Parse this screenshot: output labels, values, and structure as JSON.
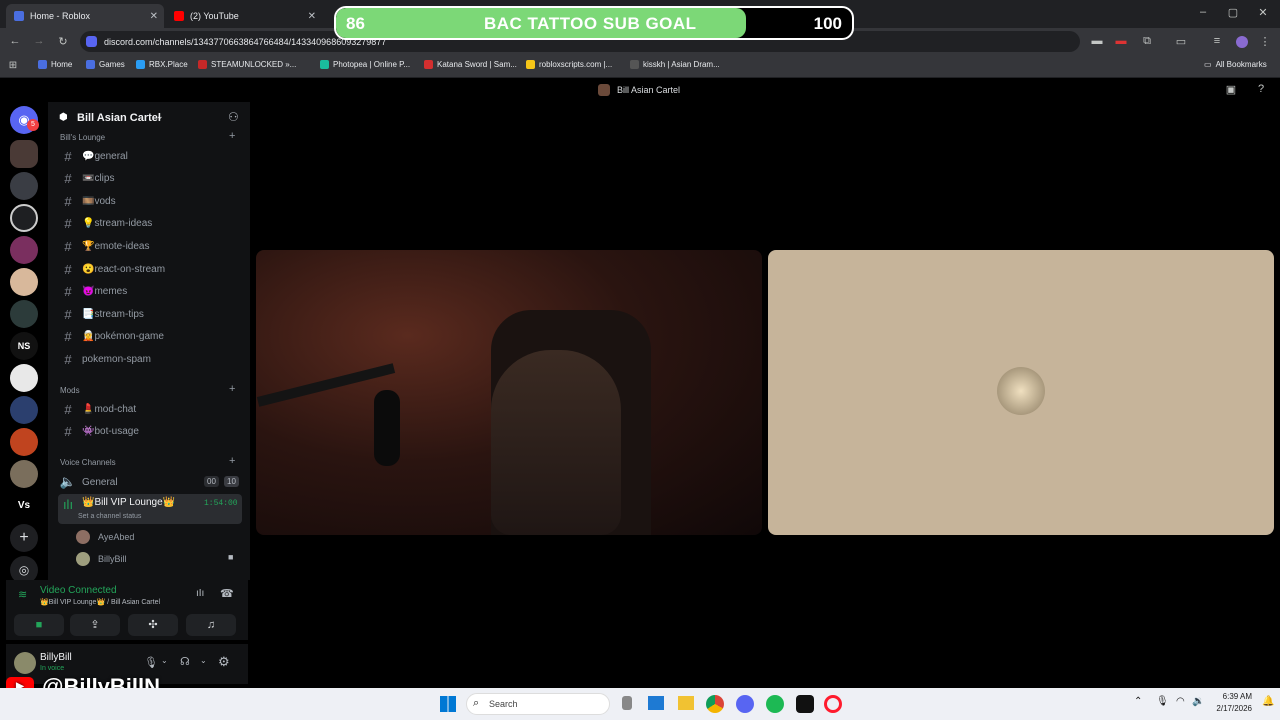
{
  "tabs": [
    {
      "title": "Home - Roblox"
    },
    {
      "title": "(2) YouTube"
    }
  ],
  "url": "discord.com/channels/1343770663864766484/1433409686093279877",
  "bookmarks": [
    "Home",
    "Games",
    "RBX.Place",
    "STEAMUNLOCKED »...",
    "Photopea | Online P...",
    "Katana Sword | Sam...",
    "robloxscripts.com |...",
    "kisskh | Asian Dram..."
  ],
  "all_bookmarks": "All Bookmarks",
  "goal": {
    "current": "86",
    "label": "BAC TATTOO SUB GOAL",
    "target": "100",
    "progress": 0.86
  },
  "window_title": "Bill Asian Cartel",
  "server": {
    "name": "Bill Asian Cartel"
  },
  "categories": {
    "lounge": "Bill's Lounge",
    "mods": "Mods",
    "voice": "Voice Channels"
  },
  "channels": [
    "💬general",
    "📼clips",
    "🎞️vods",
    "💡stream-ideas",
    "🏆emote-ideas",
    "😮react-on-stream",
    "😈memes",
    "📑stream-tips",
    "🧝pokémon-game",
    "pokemon-spam"
  ],
  "mod_channels": [
    "💄mod-chat",
    "👾bot-usage"
  ],
  "voice": {
    "general": "General",
    "general_counts": [
      "00",
      "10"
    ],
    "vip": "👑Bill VIP Lounge👑",
    "vip_time": "1:54:00",
    "vip_status": "Set a channel status",
    "members": [
      "AyeAbed",
      "BillyBill"
    ]
  },
  "connection": {
    "status": "Video Connected",
    "location": "👑Bill VIP Lounge👑 / Bill Asian Cartel"
  },
  "user": {
    "name": "BillyBill",
    "status": "In voice"
  },
  "guild_badge": "5",
  "guild_ns": "NS",
  "guild_vs": "Vs",
  "watermark": "@BillyBillN",
  "taskbar": {
    "search": "Search",
    "time": "6:39 AM",
    "date": "2/17/2026"
  },
  "colors": {
    "goal_fill": "#7cd877",
    "discord_green": "#23a55a",
    "bg": "#000000"
  }
}
